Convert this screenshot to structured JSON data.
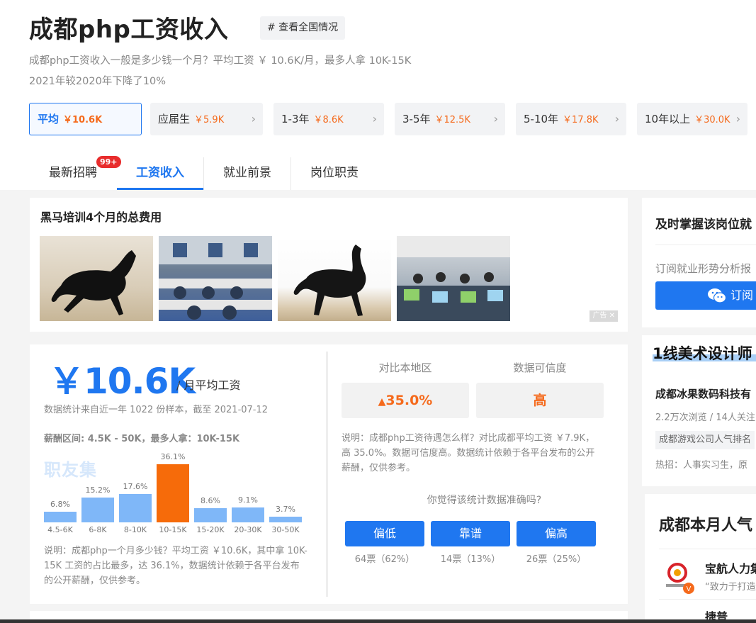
{
  "header": {
    "title": "成都php工资收入",
    "national_button": "# 查看全国情况",
    "desc_line1": "成都php工资收入一般是多少钱一个月？平均工资 ￥ 10.6K/月，最多人拿 10K-15K",
    "desc_line2": "2021年较2020年下降了10%"
  },
  "experience_tabs": [
    {
      "label": "平均",
      "salary": "￥10.6K",
      "active": true
    },
    {
      "label": "应届生",
      "salary": "￥5.9K"
    },
    {
      "label": "1-3年",
      "salary": "￥8.6K"
    },
    {
      "label": "3-5年",
      "salary": "￥12.5K"
    },
    {
      "label": "5-10年",
      "salary": "￥17.8K"
    },
    {
      "label": "10年以上",
      "salary": "￥30.0K"
    }
  ],
  "main_tabs": [
    {
      "label": "最新招聘",
      "badge": "99+"
    },
    {
      "label": "工资收入",
      "active": true
    },
    {
      "label": "就业前景"
    },
    {
      "label": "岗位职责"
    }
  ],
  "ad": {
    "title": "黑马培训4个月的总费用",
    "mark": "广告 ✕"
  },
  "salary": {
    "value": "￥10.6K",
    "unit": "/ 月平均工资",
    "source": "数据统计来自近一年 1022 份样本，截至 2021-07-12",
    "range": "薪酬区间: 4.5K - 50K，最多人拿：10K-15K",
    "watermark": "职友集",
    "note": "说明：成都php一个月多少钱？平均工资 ￥10.6K，其中拿 10K-15K 工资的占比最多，达 36.1%，数据统计依赖于各平台发布的公开薪酬，仅供参考。"
  },
  "chart_data": {
    "type": "bar",
    "categories": [
      "4.5-6K",
      "6-8K",
      "8-10K",
      "10-15K",
      "15-20K",
      "20-30K",
      "30-50K"
    ],
    "values": [
      6.8,
      15.2,
      17.6,
      36.1,
      8.6,
      9.1,
      3.7
    ],
    "labels": [
      "6.8%",
      "15.2%",
      "17.6%",
      "36.1%",
      "8.6%",
      "9.1%",
      "3.7%"
    ],
    "highlight_index": 3,
    "colors": {
      "normal": "#7fb7f8",
      "highlight": "#f66b0a"
    }
  },
  "compare": {
    "region_heading": "对比本地区",
    "region_value": "35.0%",
    "trust_heading": "数据可信度",
    "trust_value": "高",
    "note": "说明：成都php工资待遇怎么样？对比成都平均工资 ￥7.9K，高 35.0%。数据可信度高。数据统计依赖于各平台发布的公开薪酬，仅供参考。",
    "vote_question": "你觉得该统计数据准确吗?",
    "votes": [
      {
        "label": "偏低",
        "count": "64票（62%）"
      },
      {
        "label": "靠谱",
        "count": "14票（13%）"
      },
      {
        "label": "偏高",
        "count": "26票（25%）"
      }
    ]
  },
  "sidebar": {
    "subscribe_title": "及时掌握该岗位就",
    "subscribe_text": "订阅就业形势分析报",
    "subscribe_button": "订阅",
    "promo_title": "1线美术设计师",
    "promo_company": "成都冰果数码科技有",
    "promo_stats": "2.2万次浏览 / 14人关注",
    "promo_tag": "成都游戏公司人气排名",
    "promo_hot": "热招：人事实习生，原",
    "popular_title": "成都本月人气",
    "company1_name": "宝航人力集",
    "company1_slogan": "“致力于打造",
    "company2_name": "捷普"
  },
  "colors": {
    "accent": "#1f77f0",
    "orange": "#f56a1c"
  }
}
